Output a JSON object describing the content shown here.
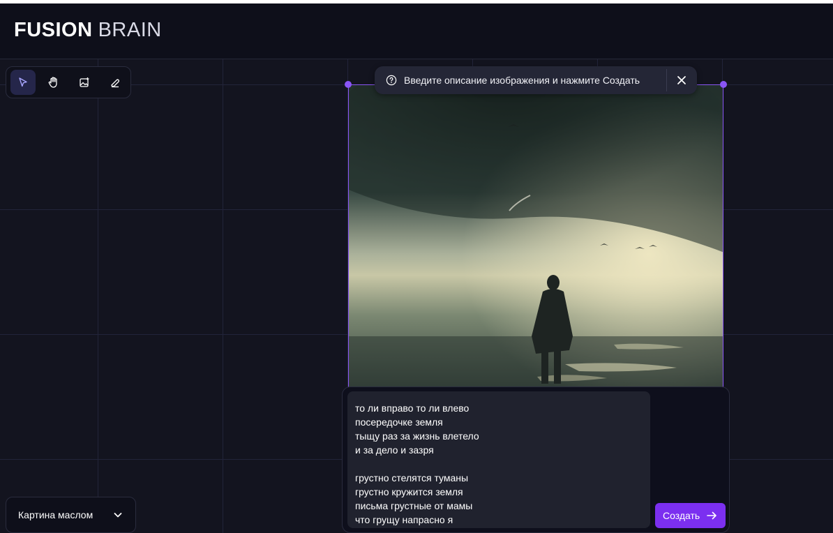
{
  "header": {
    "logo_bold": "FUSION",
    "logo_light": "BRAIN"
  },
  "toolbar": {
    "tools": [
      {
        "name": "select",
        "icon": "cursor-arrow-icon",
        "active": true
      },
      {
        "name": "pan",
        "icon": "hand-icon",
        "active": false
      },
      {
        "name": "add-image",
        "icon": "image-plus-icon",
        "active": false
      },
      {
        "name": "erase",
        "icon": "eraser-icon",
        "active": false
      }
    ]
  },
  "hint": {
    "icon": "question-circle-icon",
    "text": "Введите описание изображения и нажмите Создать",
    "close_icon": "close-icon"
  },
  "prompt": {
    "text": "то ли вправо то ли влево\nпосередочке земля\nтыщу раз за жизнь влетело\nи за дело и зазря\n\nгрустно стелятся туманы\nгрустно кружится земля\nписьма грустные от мамы\nчто грущу напрасно я",
    "button_label": "Создать",
    "button_icon": "arrow-right-icon"
  },
  "style_select": {
    "value": "Картина маслом",
    "icon": "chevron-down-icon"
  },
  "colors": {
    "accent": "#7b2ff0",
    "selection": "#8a55f5",
    "background": "#13141f",
    "header_bg": "#0e0f1a",
    "panel_bg": "#242636"
  }
}
